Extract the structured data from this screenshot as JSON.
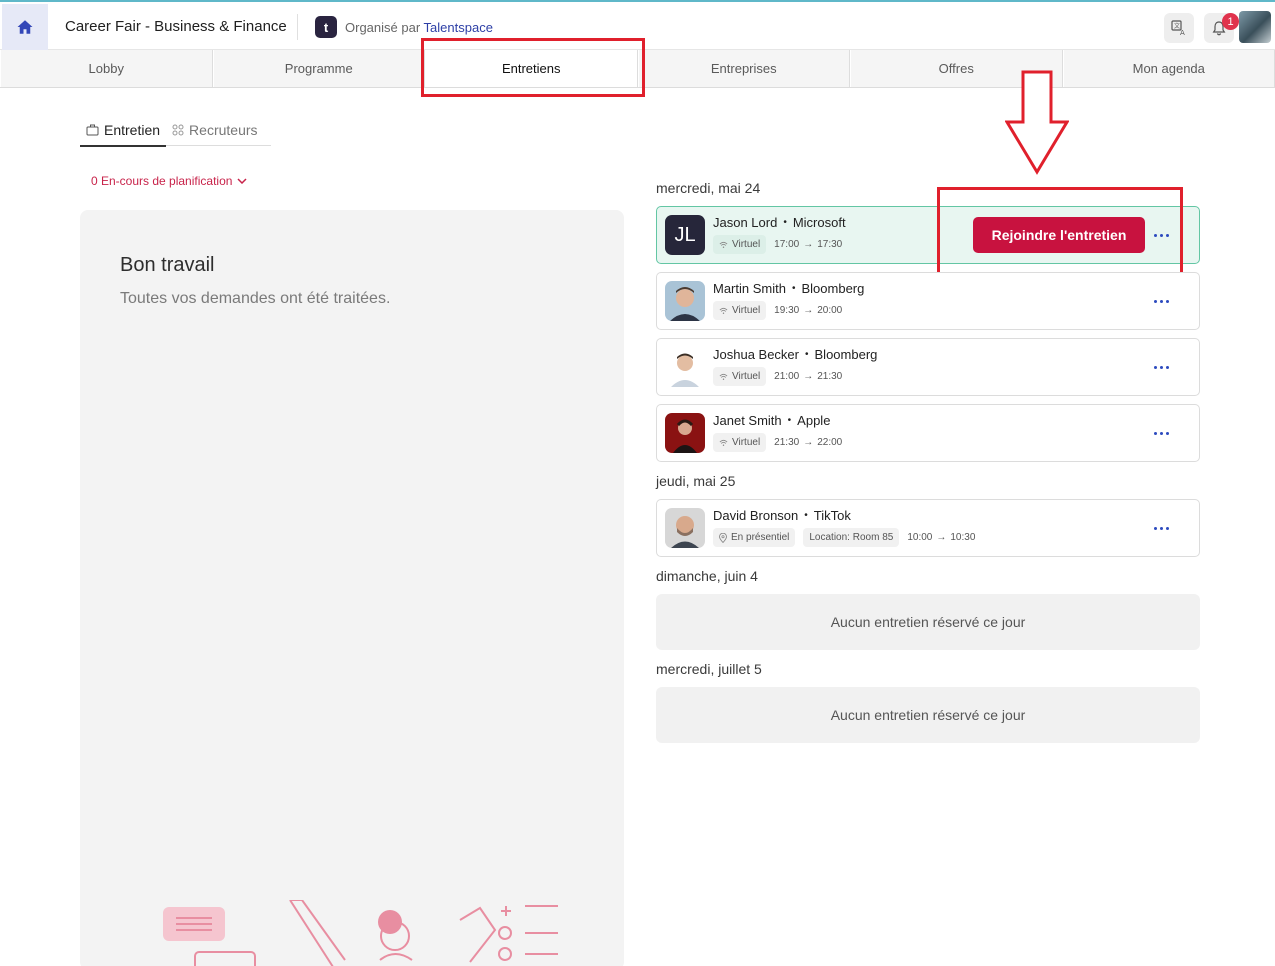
{
  "header": {
    "event_title": "Career Fair - Business & Finance",
    "organized_by_prefix": "Organisé par",
    "organizer_name": "Talentspace",
    "organizer_logo_letter": "t",
    "notification_count": "1"
  },
  "nav": {
    "tabs": [
      {
        "label": "Lobby"
      },
      {
        "label": "Programme"
      },
      {
        "label": "Entretiens"
      },
      {
        "label": "Entreprises"
      },
      {
        "label": "Offres"
      },
      {
        "label": "Mon agenda"
      }
    ],
    "active_tab": "Entretiens"
  },
  "subtabs": {
    "entretien": "Entretien",
    "recruteurs": "Recruteurs"
  },
  "planning_filter": "0 En-cours de planification",
  "left_panel": {
    "title": "Bon travail",
    "subtitle": "Toutes vos demandes ont été traitées."
  },
  "days": {
    "d1": "mercredi, mai 24",
    "d2": "jeudi, mai 25",
    "d3": "dimanche, juin 4",
    "d4": "mercredi, juillet 5"
  },
  "interviews": [
    {
      "name": "Jason Lord",
      "company": "Microsoft",
      "mode": "Virtuel",
      "start": "17:00",
      "end": "17:30",
      "initials": "JL",
      "join_label": "Rejoindre l'entretien"
    },
    {
      "name": "Martin Smith",
      "company": "Bloomberg",
      "mode": "Virtuel",
      "start": "19:30",
      "end": "20:00"
    },
    {
      "name": "Joshua Becker",
      "company": "Bloomberg",
      "mode": "Virtuel",
      "start": "21:00",
      "end": "21:30"
    },
    {
      "name": "Janet Smith",
      "company": "Apple",
      "mode": "Virtuel",
      "start": "21:30",
      "end": "22:00"
    },
    {
      "name": "David Bronson",
      "company": "TikTok",
      "mode": "En présentiel",
      "location": "Location: Room 85",
      "start": "10:00",
      "end": "10:30"
    }
  ],
  "empty_day_text": "Aucun entretien réservé ce jour",
  "colors": {
    "accent": "#c8123f",
    "highlight_card": "#e8f6f1",
    "annotation": "#e0202c",
    "link_blue": "#2d3fa6"
  }
}
